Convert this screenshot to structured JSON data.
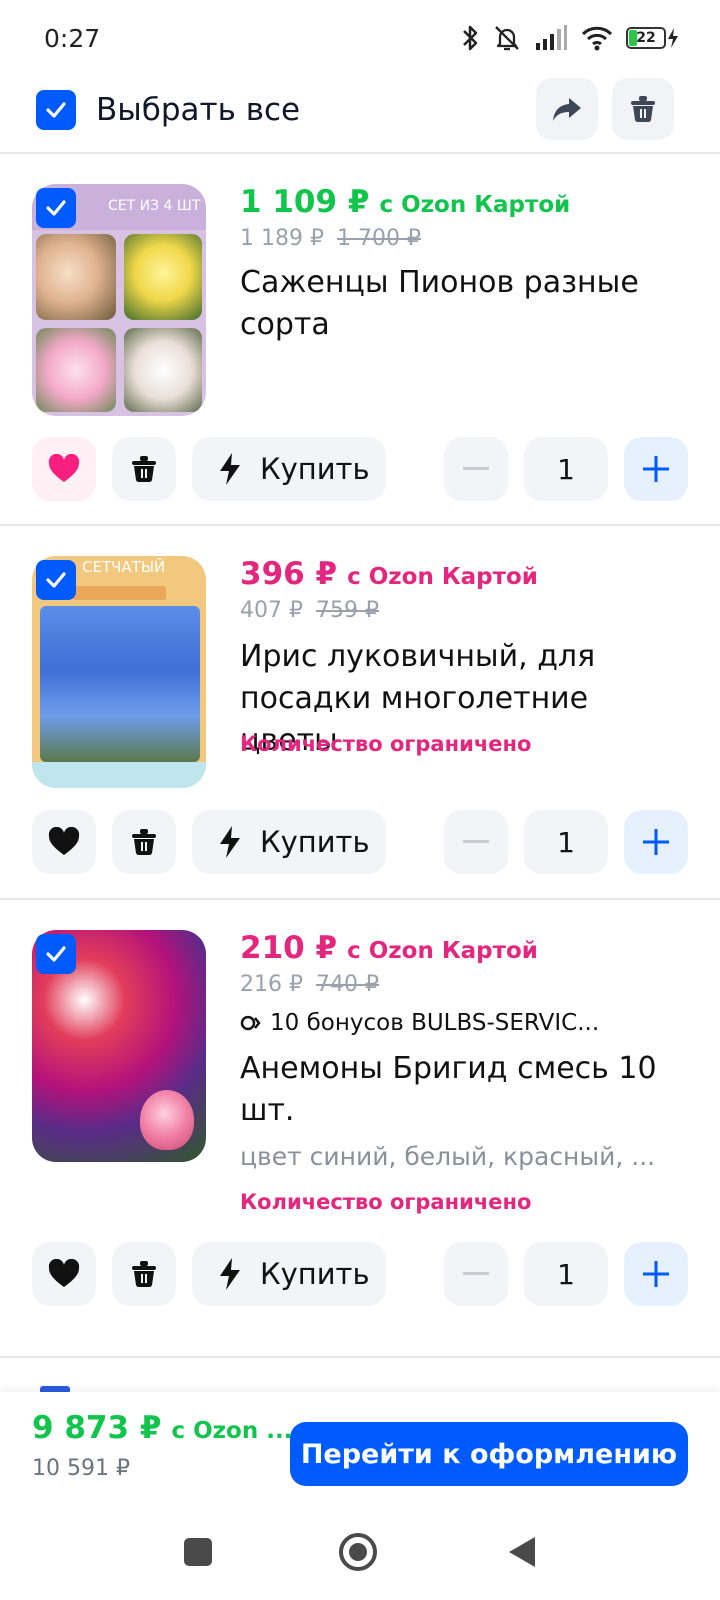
{
  "status": {
    "time": "0:27",
    "battery": "22"
  },
  "header": {
    "select_all_label": "Выбрать все"
  },
  "items": [
    {
      "image_caption": "СЕТ ИЗ 4 ШТ",
      "price": "1 109 ₽",
      "price_color": "#10c44c",
      "card_label": "с Ozon Картой",
      "price_regular": "1 189 ₽",
      "price_old": "1 700 ₽",
      "title": "Саженцы Пионов разные сорта",
      "favorite": true,
      "buy_label": "Купить",
      "quantity": "1"
    },
    {
      "image_caption": "СЕТЧАТЫЙ",
      "price": "396 ₽",
      "price_color": "#e3267e",
      "card_label": "с Ozon Картой",
      "price_regular": "407 ₽",
      "price_old": "759 ₽",
      "title": "Ирис луковичный, для посадки многолетние цветы",
      "limited": "Количество ограничено",
      "favorite": false,
      "buy_label": "Купить",
      "quantity": "1"
    },
    {
      "price": "210 ₽",
      "price_color": "#e3267e",
      "card_label": "с Ozon Картой",
      "price_regular": "216 ₽",
      "price_old": "740 ₽",
      "bonus": "10 бонусов BULBS-SERVIC...",
      "title": "Анемоны Бригид смесь 10 шт.",
      "attributes": "цвет синий, белый, красный, ...",
      "limited": "Количество ограничено",
      "favorite": false,
      "buy_label": "Купить",
      "quantity": "1"
    }
  ],
  "footer": {
    "total": "9 873 ₽",
    "total_card_label": "с Ozon ...",
    "total_regular": "10 591 ₽",
    "checkout_label": "Перейти к оформлению"
  },
  "colors": {
    "accent": "#005bff",
    "green": "#10c44c",
    "pink": "#e3267e"
  }
}
